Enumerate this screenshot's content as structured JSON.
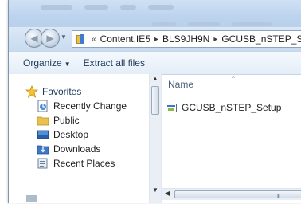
{
  "address_bar": {
    "overflow_chevron": "«",
    "segments": [
      "Content.IE5",
      "BLS9JH9N",
      "GCUSB_nSTEP_Set"
    ],
    "separator": "▸"
  },
  "toolbar": {
    "organize_label": "Organize",
    "extract_label": "Extract all files"
  },
  "navigation_pane": {
    "favorites_label": "Favorites",
    "items": [
      {
        "label": "Recently Change",
        "icon": "recent-changes-icon"
      },
      {
        "label": "Public",
        "icon": "folder-icon"
      },
      {
        "label": "Desktop",
        "icon": "desktop-icon"
      },
      {
        "label": "Downloads",
        "icon": "downloads-icon"
      },
      {
        "label": "Recent Places",
        "icon": "recent-places-icon"
      }
    ]
  },
  "file_list": {
    "column_name": "Name",
    "files": [
      {
        "name": "GCUSB_nSTEP_Setup",
        "icon": "installer-icon"
      }
    ]
  },
  "scroll": {
    "hscroll_grip": "III"
  },
  "colors": {
    "nav_gradient_top": "#dbe8f6",
    "toolbar_text": "#1e395b",
    "folder_yellow": "#e8c14e"
  }
}
